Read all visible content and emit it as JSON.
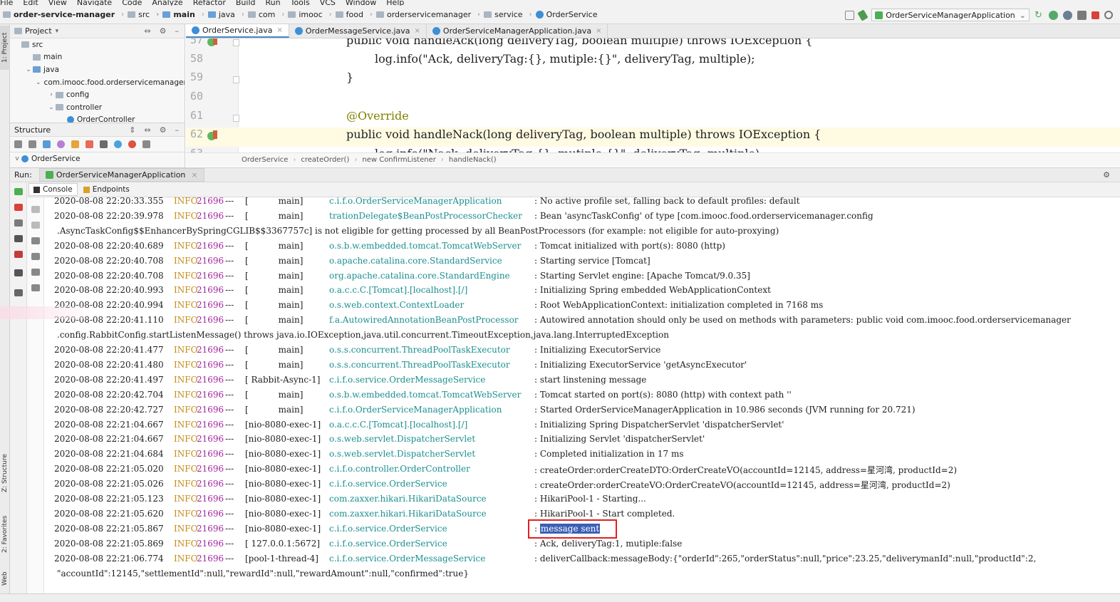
{
  "menubar": [
    "File",
    "Edit",
    "View",
    "Navigate",
    "Code",
    "Analyze",
    "Refactor",
    "Build",
    "Run",
    "Tools",
    "VCS",
    "Window",
    "Help"
  ],
  "nav": {
    "project": "order-service-manager",
    "crumbs": [
      "src",
      "main",
      "java",
      "com",
      "imooc",
      "food",
      "orderservicemanager",
      "service",
      "OrderService"
    ],
    "run_config": "OrderServiceManagerApplication"
  },
  "left_tabs": {
    "project": "1: Project",
    "structure": "Z: Structure",
    "favorites": "2: Favorites",
    "web": "Web"
  },
  "project_panel": {
    "title": "Project",
    "tree": [
      {
        "label": "src",
        "indent": 0,
        "arrow": ""
      },
      {
        "label": "main",
        "indent": 1,
        "arrow": ""
      },
      {
        "label": "java",
        "indent": 1,
        "arrow": "v"
      },
      {
        "label": "com.imooc.food.orderservicemanager",
        "indent": 2,
        "arrow": "v"
      },
      {
        "label": "config",
        "indent": 3,
        "arrow": ">"
      },
      {
        "label": "controller",
        "indent": 3,
        "arrow": "v"
      },
      {
        "label": "OrderController",
        "indent": 4,
        "arrow": ""
      }
    ]
  },
  "structure_panel": {
    "title": "Structure",
    "root": "OrderService"
  },
  "editor": {
    "tabs": [
      {
        "label": "OrderService.java",
        "active": true
      },
      {
        "label": "OrderMessageService.java",
        "active": false
      },
      {
        "label": "OrderServiceManagerApplication.java",
        "active": false
      }
    ],
    "lines": [
      {
        "num": "57",
        "text": "public void handleAck(long deliveryTag, boolean multiple) throws IOException {"
      },
      {
        "num": "58",
        "text": "log.info(\"Ack, deliveryTag:{}, mutiple:{}\", deliveryTag, multiple);"
      },
      {
        "num": "59",
        "text": "}"
      },
      {
        "num": "60",
        "text": ""
      },
      {
        "num": "61",
        "text": "@Override"
      },
      {
        "num": "62",
        "text": "public void handleNack(long deliveryTag, boolean multiple) throws IOException {"
      },
      {
        "num": "63",
        "text": "log.info(\"Nack, deliveryTag:{}, mutiple:{}\", deliveryTag, multiple);"
      }
    ],
    "breadcrumb": [
      "OrderService",
      "createOrder()",
      "new ConfirmListener",
      "handleNack()"
    ]
  },
  "run": {
    "label": "Run:",
    "tab": "OrderServiceManagerApplication",
    "console_tabs": [
      "Console",
      "Endpoints"
    ]
  },
  "console_lines": [
    {
      "ts": "2020-08-08 22:20:33.355",
      "lv": "INFO",
      "pid": "21696",
      "th": "[           main]",
      "lg": "c.i.f.o.OrderServiceManagerApplication",
      "msg": ": No active profile set, falling back to default profiles: default"
    },
    {
      "ts": "2020-08-08 22:20:39.978",
      "lv": "INFO",
      "pid": "21696",
      "th": "[           main]",
      "lg": "trationDelegate$BeanPostProcessorChecker",
      "msg": ": Bean 'asyncTaskConfig' of type [com.imooc.food.orderservicemanager.config"
    },
    {
      "cont": ".AsyncTaskConfig$$EnhancerBySpringCGLIB$$3367757c] is not eligible for getting processed by all BeanPostProcessors (for example: not eligible for auto-proxying)"
    },
    {
      "ts": "2020-08-08 22:20:40.689",
      "lv": "INFO",
      "pid": "21696",
      "th": "[           main]",
      "lg": "o.s.b.w.embedded.tomcat.TomcatWebServer",
      "msg": ": Tomcat initialized with port(s): 8080 (http)"
    },
    {
      "ts": "2020-08-08 22:20:40.708",
      "lv": "INFO",
      "pid": "21696",
      "th": "[           main]",
      "lg": "o.apache.catalina.core.StandardService",
      "msg": ": Starting service [Tomcat]"
    },
    {
      "ts": "2020-08-08 22:20:40.708",
      "lv": "INFO",
      "pid": "21696",
      "th": "[           main]",
      "lg": "org.apache.catalina.core.StandardEngine",
      "msg": ": Starting Servlet engine: [Apache Tomcat/9.0.35]"
    },
    {
      "ts": "2020-08-08 22:20:40.993",
      "lv": "INFO",
      "pid": "21696",
      "th": "[           main]",
      "lg": "o.a.c.c.C.[Tomcat].[localhost].[/]",
      "msg": ": Initializing Spring embedded WebApplicationContext"
    },
    {
      "ts": "2020-08-08 22:20:40.994",
      "lv": "INFO",
      "pid": "21696",
      "th": "[           main]",
      "lg": "o.s.web.context.ContextLoader",
      "msg": ": Root WebApplicationContext: initialization completed in 7168 ms"
    },
    {
      "ts": "2020-08-08 22:20:41.110",
      "lv": "INFO",
      "pid": "21696",
      "th": "[           main]",
      "lg": "f.a.AutowiredAnnotationBeanPostProcessor",
      "msg": ": Autowired annotation should only be used on methods with parameters: public void com.imooc.food.orderservicemanager"
    },
    {
      "cont": ".config.RabbitConfig.startListenMessage() throws java.io.IOException,java.util.concurrent.TimeoutException,java.lang.InterruptedException"
    },
    {
      "ts": "2020-08-08 22:20:41.477",
      "lv": "INFO",
      "pid": "21696",
      "th": "[           main]",
      "lg": "o.s.s.concurrent.ThreadPoolTaskExecutor",
      "msg": ": Initializing ExecutorService"
    },
    {
      "ts": "2020-08-08 22:20:41.480",
      "lv": "INFO",
      "pid": "21696",
      "th": "[           main]",
      "lg": "o.s.s.concurrent.ThreadPoolTaskExecutor",
      "msg": ": Initializing ExecutorService 'getAsyncExecutor'"
    },
    {
      "ts": "2020-08-08 22:20:41.497",
      "lv": "INFO",
      "pid": "21696",
      "th": "[ Rabbit-Async-1]",
      "lg": "c.i.f.o.service.OrderMessageService",
      "msg": ": start linstening message"
    },
    {
      "ts": "2020-08-08 22:20:42.704",
      "lv": "INFO",
      "pid": "21696",
      "th": "[           main]",
      "lg": "o.s.b.w.embedded.tomcat.TomcatWebServer",
      "msg": ": Tomcat started on port(s): 8080 (http) with context path ''"
    },
    {
      "ts": "2020-08-08 22:20:42.727",
      "lv": "INFO",
      "pid": "21696",
      "th": "[           main]",
      "lg": "c.i.f.o.OrderServiceManagerApplication",
      "msg": ": Started OrderServiceManagerApplication in 10.986 seconds (JVM running for 20.721)"
    },
    {
      "ts": "2020-08-08 22:21:04.667",
      "lv": "INFO",
      "pid": "21696",
      "th": "[nio-8080-exec-1]",
      "lg": "o.a.c.c.C.[Tomcat].[localhost].[/]",
      "msg": ": Initializing Spring DispatcherServlet 'dispatcherServlet'"
    },
    {
      "ts": "2020-08-08 22:21:04.667",
      "lv": "INFO",
      "pid": "21696",
      "th": "[nio-8080-exec-1]",
      "lg": "o.s.web.servlet.DispatcherServlet",
      "msg": ": Initializing Servlet 'dispatcherServlet'"
    },
    {
      "ts": "2020-08-08 22:21:04.684",
      "lv": "INFO",
      "pid": "21696",
      "th": "[nio-8080-exec-1]",
      "lg": "o.s.web.servlet.DispatcherServlet",
      "msg": ": Completed initialization in 17 ms"
    },
    {
      "ts": "2020-08-08 22:21:05.020",
      "lv": "INFO",
      "pid": "21696",
      "th": "[nio-8080-exec-1]",
      "lg": "c.i.f.o.controller.OrderController",
      "msg": ": createOrder:orderCreateDTO:OrderCreateVO(accountId=12145, address=星河湾, productId=2)"
    },
    {
      "ts": "2020-08-08 22:21:05.026",
      "lv": "INFO",
      "pid": "21696",
      "th": "[nio-8080-exec-1]",
      "lg": "c.i.f.o.service.OrderService",
      "msg": ": createOrder:orderCreateVO:OrderCreateVO(accountId=12145, address=星河湾, productId=2)"
    },
    {
      "ts": "2020-08-08 22:21:05.123",
      "lv": "INFO",
      "pid": "21696",
      "th": "[nio-8080-exec-1]",
      "lg": "com.zaxxer.hikari.HikariDataSource",
      "msg": ": HikariPool-1 - Starting..."
    },
    {
      "ts": "2020-08-08 22:21:05.620",
      "lv": "INFO",
      "pid": "21696",
      "th": "[nio-8080-exec-1]",
      "lg": "com.zaxxer.hikari.HikariDataSource",
      "msg": ": HikariPool-1 - Start completed."
    },
    {
      "ts": "2020-08-08 22:21:05.867",
      "lv": "INFO",
      "pid": "21696",
      "th": "[nio-8080-exec-1]",
      "lg": "c.i.f.o.service.OrderService",
      "msg": ": ",
      "sel": "message sent"
    },
    {
      "ts": "2020-08-08 22:21:05.869",
      "lv": "INFO",
      "pid": "21696",
      "th": "[ 127.0.0.1:5672]",
      "lg": "c.i.f.o.service.OrderService",
      "msg": ": Ack, deliveryTag:1, mutiple:false"
    },
    {
      "ts": "2020-08-08 22:21:06.774",
      "lv": "INFO",
      "pid": "21696",
      "th": "[pool-1-thread-4]",
      "lg": "c.i.f.o.service.OrderMessageService",
      "msg": ": deliverCallback:messageBody:{\"orderId\":265,\"orderStatus\":null,\"price\":23.25,\"deliverymanId\":null,\"productId\":2,"
    },
    {
      "cont": "\"accountId\":12145,\"settlementId\":null,\"rewardId\":null,\"rewardAmount\":null,\"confirmed\":true}"
    }
  ],
  "colors": {
    "accent": "#4a88c7",
    "selection": "#3b5fb5",
    "highlight_box": "#e02020"
  }
}
